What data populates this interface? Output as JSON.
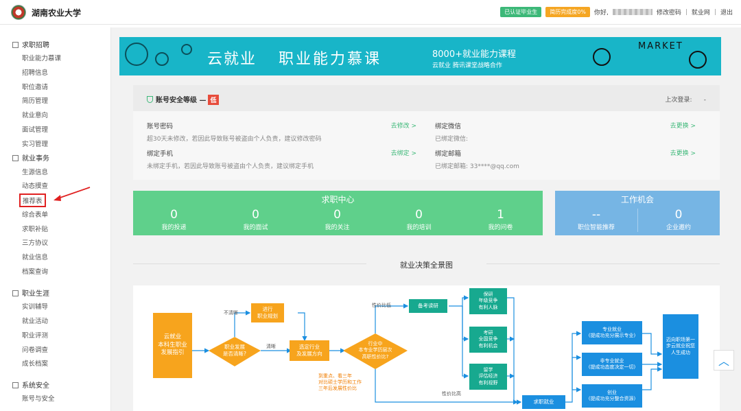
{
  "header": {
    "brand": "湖南农业大学",
    "badge_graduate": "已认证毕业生",
    "badge_resume": "简历完成度0%",
    "greeting": "你好,",
    "change_password": "修改密码",
    "employment_site": "就业网",
    "logout": "退出",
    "sep": "|"
  },
  "sidebar": {
    "groups": [
      {
        "label": "求职招聘",
        "items": [
          "职业能力慕课",
          "招聘信息",
          "职位邀请",
          "简历管理",
          "就业意向",
          "面试管理",
          "实习管理"
        ]
      },
      {
        "label": "就业事务",
        "items": [
          "生源信息",
          "动态摸查",
          "推荐表",
          "综合表单",
          "求职补贴",
          "三方协议",
          "就业信息",
          "档案查询"
        ]
      },
      {
        "label": "职业生涯",
        "items": [
          "实训辅导",
          "就业活动",
          "职业评测",
          "问卷调查",
          "成长档案"
        ]
      },
      {
        "label": "系统安全",
        "items": [
          "账号与安全"
        ]
      }
    ],
    "active_item": "推荐表"
  },
  "banner": {
    "title1": "云就业",
    "title2": "职业能力慕课",
    "course_count": "8000+就业能力课程",
    "partner": "云就业 腾讯课堂战略合作",
    "market": "MARKET"
  },
  "security": {
    "title": "账号安全等级 —",
    "level": "低",
    "last_login_label": "上次登录:",
    "last_login_value": "-",
    "items": [
      {
        "name": "账号密码",
        "desc": "超30天未修改，若因此导致账号被盗由个人负责，建议修改密码",
        "link": "去修改 >"
      },
      {
        "name": "绑定微信",
        "desc": "已绑定微信:",
        "link": "去更换 >"
      },
      {
        "name": "绑定手机",
        "desc": "未绑定手机，若因此导致账号被盗由个人负责，建议绑定手机",
        "link": "去绑定 >"
      },
      {
        "name": "绑定邮箱",
        "desc": "已绑定邮箱: 33****@qq.com",
        "link": "去更换 >"
      }
    ]
  },
  "job_center": {
    "title": "求职中心",
    "stats": [
      {
        "value": "0",
        "label": "我的投递"
      },
      {
        "value": "0",
        "label": "我的面试"
      },
      {
        "value": "0",
        "label": "我的关注"
      },
      {
        "value": "0",
        "label": "我的培训"
      },
      {
        "value": "1",
        "label": "我的问卷"
      }
    ]
  },
  "work_opportunity": {
    "title": "工作机会",
    "stats": [
      {
        "value": "--",
        "label": "职位智能推荐"
      },
      {
        "value": "0",
        "label": "企业邀约"
      }
    ]
  },
  "panorama": {
    "title": "就业决策全景图"
  },
  "flow": {
    "start": [
      "云就业",
      "本科生职业",
      "发展指引"
    ],
    "diamond1": [
      "职业发展",
      "是否清晰?"
    ],
    "unclear": "不清晰",
    "clear": "清晰",
    "plan": [
      "进行",
      "职业规划"
    ],
    "select_industry": [
      "选定行业",
      "及发展方向"
    ],
    "diamond2": [
      "行业中",
      "本专业学历层次",
      "高职性价比?"
    ],
    "ratio_low": "性价比低",
    "ratio_high": "性价比高",
    "note": [
      "到重点、看三年",
      "对比硕士学历和工作",
      "三年后发展性价比"
    ],
    "exam_prep": "备考读研",
    "branches": [
      [
        "保研",
        "年级竞争",
        "有利人脉"
      ],
      [
        "考研",
        "全国竞争",
        "有利机会"
      ],
      [
        "留学",
        "评估经济",
        "有利视野"
      ]
    ],
    "job_seek": "求职就业",
    "outcomes": [
      [
        "专业就业",
        "(提成功充分展示专业)"
      ],
      [
        "非专业就业",
        "(提成功态度决定一切)"
      ],
      [
        "创业",
        "(提成功充分整合资源)"
      ]
    ],
    "final": [
      "迈向职场第一",
      "步云就业祝您",
      "人生成功"
    ]
  },
  "colors": {
    "green": "#5fd08b",
    "blue": "#76b5e4",
    "banner": "#18b5c8",
    "orange": "#f7a41d",
    "teal": "#17a98f",
    "flow_blue": "#1b8fe0"
  }
}
